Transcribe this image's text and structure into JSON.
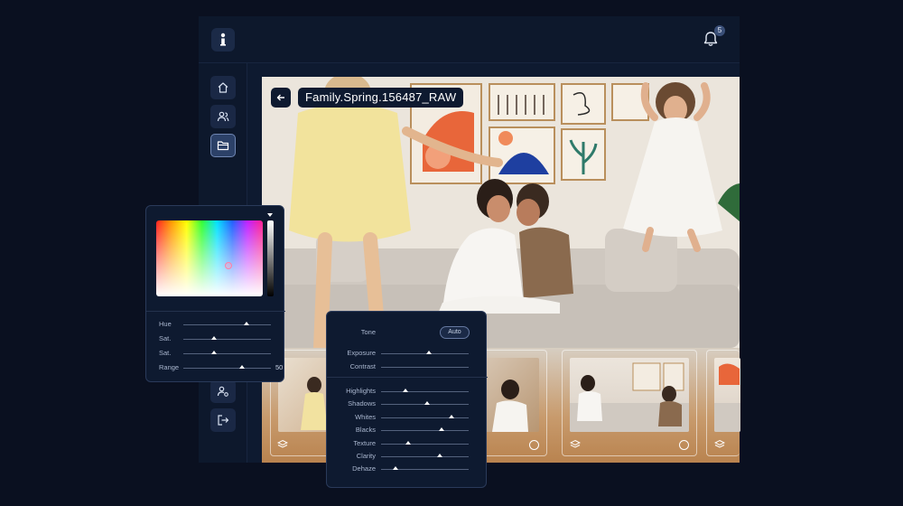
{
  "notifications": {
    "count": "5"
  },
  "sidebar": {
    "items": [
      {
        "name": "home",
        "active": false
      },
      {
        "name": "users",
        "active": false
      },
      {
        "name": "folder",
        "active": true
      },
      {
        "name": "user-settings",
        "active": false
      },
      {
        "name": "logout",
        "active": false
      }
    ]
  },
  "editor": {
    "file_name": "Family.Spring.156487_RAW"
  },
  "color_panel": {
    "sliders": [
      {
        "label": "Hue",
        "level": 0.72,
        "value": ""
      },
      {
        "label": "Sat.",
        "level": 0.35,
        "value": ""
      },
      {
        "label": "Sat.",
        "level": 0.35,
        "value": ""
      },
      {
        "label": "Range",
        "level": 0.67,
        "value": "50"
      }
    ]
  },
  "tone_panel": {
    "title": "Tone",
    "auto_label": "Auto",
    "sliders_top": [
      {
        "label": "Exposure",
        "level": 0.55
      },
      {
        "label": "Contrast",
        "level": null
      }
    ],
    "sliders_bottom": [
      {
        "label": "Highlights",
        "level": 0.28
      },
      {
        "label": "Shadows",
        "level": 0.53
      },
      {
        "label": "Whites",
        "level": 0.8
      },
      {
        "label": "Blacks",
        "level": 0.69
      },
      {
        "label": "Texture",
        "level": 0.31
      },
      {
        "label": "Clarity",
        "level": 0.67
      },
      {
        "label": "Dehaze",
        "level": 0.16
      }
    ]
  },
  "colors": {
    "accent": "#2c4168",
    "background": "#0a1020",
    "panel": "#0e1a30"
  }
}
